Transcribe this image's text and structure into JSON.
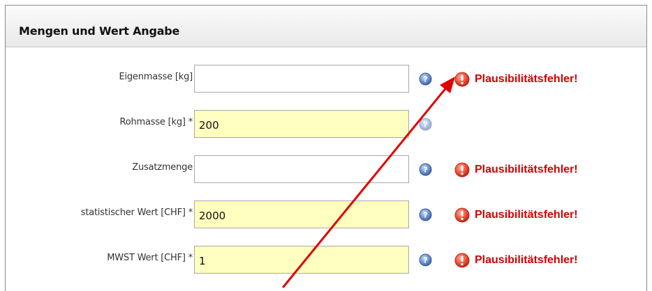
{
  "panel": {
    "title": "Mengen und Wert Angabe"
  },
  "fields": [
    {
      "label": "Eigenmasse [kg]",
      "value": "",
      "mandatory": false,
      "error": "Plausibilitätsfehler!"
    },
    {
      "label": "Rohmasse [kg] *",
      "value": "200",
      "mandatory": true,
      "error": ""
    },
    {
      "label": "Zusatzmenge",
      "value": "",
      "mandatory": false,
      "error": "Plausibilitätsfehler!"
    },
    {
      "label": "statistischer Wert [CHF] *",
      "value": "2000",
      "mandatory": true,
      "error": "Plausibilitätsfehler!"
    },
    {
      "label": "MWST Wert [CHF] *",
      "value": "1",
      "mandatory": true,
      "error": "Plausibilitätsfehler!"
    }
  ],
  "icons": {
    "help": "help-icon",
    "error": "error-icon"
  },
  "colors": {
    "mandatory_bg": "#ffffbf",
    "error_text": "#d40000",
    "arrow": "#e00000",
    "help_icon": "#4a74b8"
  }
}
